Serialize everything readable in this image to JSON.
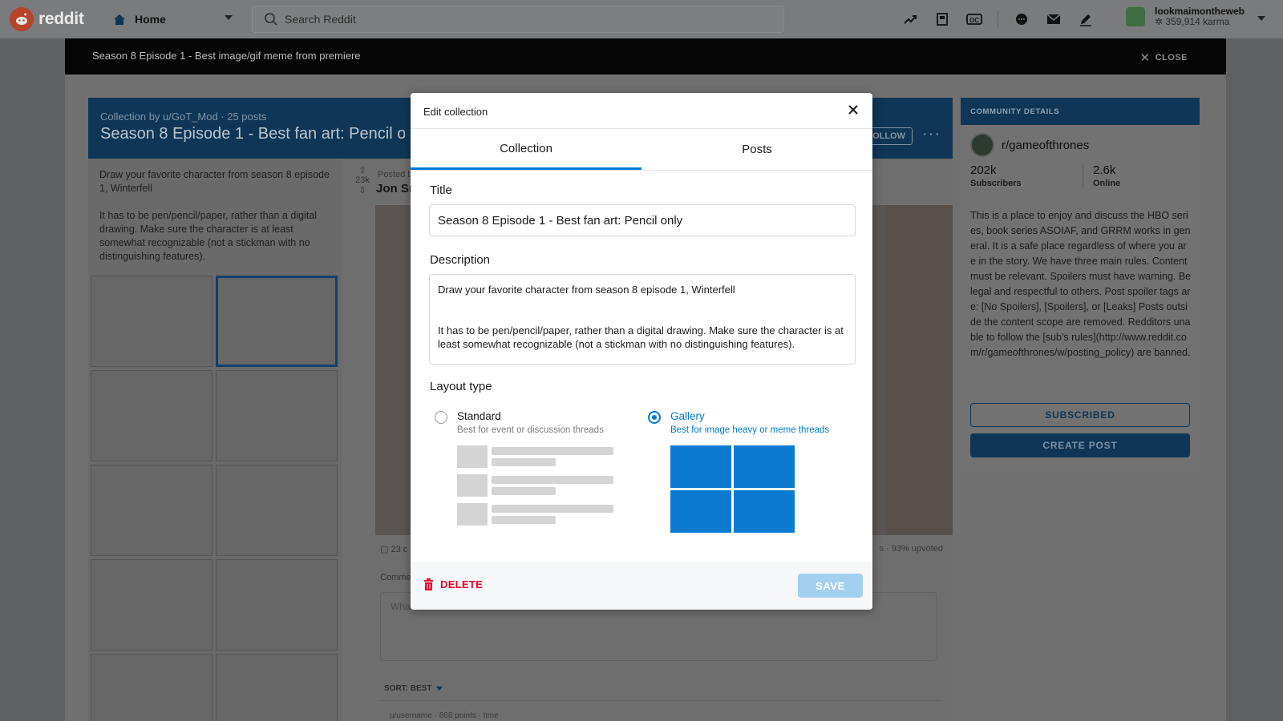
{
  "topnav": {
    "logo_text": "reddit",
    "home_label": "Home",
    "search_placeholder": "Search Reddit",
    "user_name": "lookmaimontheweb",
    "user_karma": "359,914 karma",
    "icons": [
      "trending-icon",
      "popular-icon",
      "all-icon",
      "chat-icon",
      "mail-icon",
      "create-post-icon"
    ]
  },
  "banner": {
    "title": "Season 8 Episode 1 - Best image/gif meme from premiere",
    "close_label": "CLOSE"
  },
  "collection": {
    "byline": "Collection by u/GoT_Mod · 25 posts",
    "title": "Season 8 Episode 1 - Best fan art: Pencil only",
    "follow_label": "OLLOW",
    "more_label": "···",
    "description": "Draw your favorite character from season 8 episode 1, Winterfell\n\nIt has to be pen/pencil/paper, rather than a digital drawing. Make sure the character is at least somewhat recognizable (not a stickman with no distinguishing features)."
  },
  "post": {
    "votes": "23k",
    "posted": "Posted b",
    "title": "Jon Sn",
    "comments": "23 c",
    "upvoted": "s · 93% upvoted",
    "comment_label": "Comme",
    "comment_placeholder": "What",
    "sort_label": "SORT: BEST",
    "user_row": "u/username · 888 points · time"
  },
  "sidebar": {
    "header": "COMMUNITY DETAILS",
    "subreddit": "r/gameofthrones",
    "subscribers": "202k",
    "subscribers_label": "Subscribers",
    "online": "2.6k",
    "online_label": "Online",
    "description": "This is a place to enjoy and discuss the HBO series, book series ASOIAF, and GRRM works in general. It is a safe place regardless of where you are in the story. We have three main rules. Content must be relevant. Spoilers must have warning. Be legal and respectful to others. Post spoiler tags are: [No Spoilers], [Spoilers], or [Leaks] Posts outside the content scope are removed. Redditors unable to follow the [sub's rules](http://www.reddit.com/r/gameofthrones/w/posting_policy) are banned.",
    "subscribed_label": "SUBSCRIBED",
    "create_post_label": "CREATE POST"
  },
  "modal": {
    "title": "Edit collection",
    "tabs": [
      {
        "label": "Collection",
        "active": true
      },
      {
        "label": "Posts",
        "active": false
      }
    ],
    "title_label": "Title",
    "title_value": "Season 8 Episode 1 - Best fan art: Pencil only",
    "description_label": "Description",
    "description_value": "Draw your favorite character from season 8 episode 1, Winterfell\n\n\nIt has to be pen/pencil/paper, rather than a digital drawing. Make sure the character is at least somewhat recognizable (not a stickman with no distinguishing features).",
    "layout_label": "Layout type",
    "layouts": [
      {
        "name": "Standard",
        "desc": "Best for event or discussion threads",
        "selected": false
      },
      {
        "name": "Gallery",
        "desc": "Best for image heavy or meme threads",
        "selected": true
      }
    ],
    "delete_label": "DELETE",
    "save_label": "SAVE"
  },
  "colors": {
    "accent": "#0079d3",
    "danger": "#ea0027",
    "save_disabled": "#a4d0f0",
    "overlay_nav": "#7a7b7c",
    "collection_header": "#0f3656"
  }
}
